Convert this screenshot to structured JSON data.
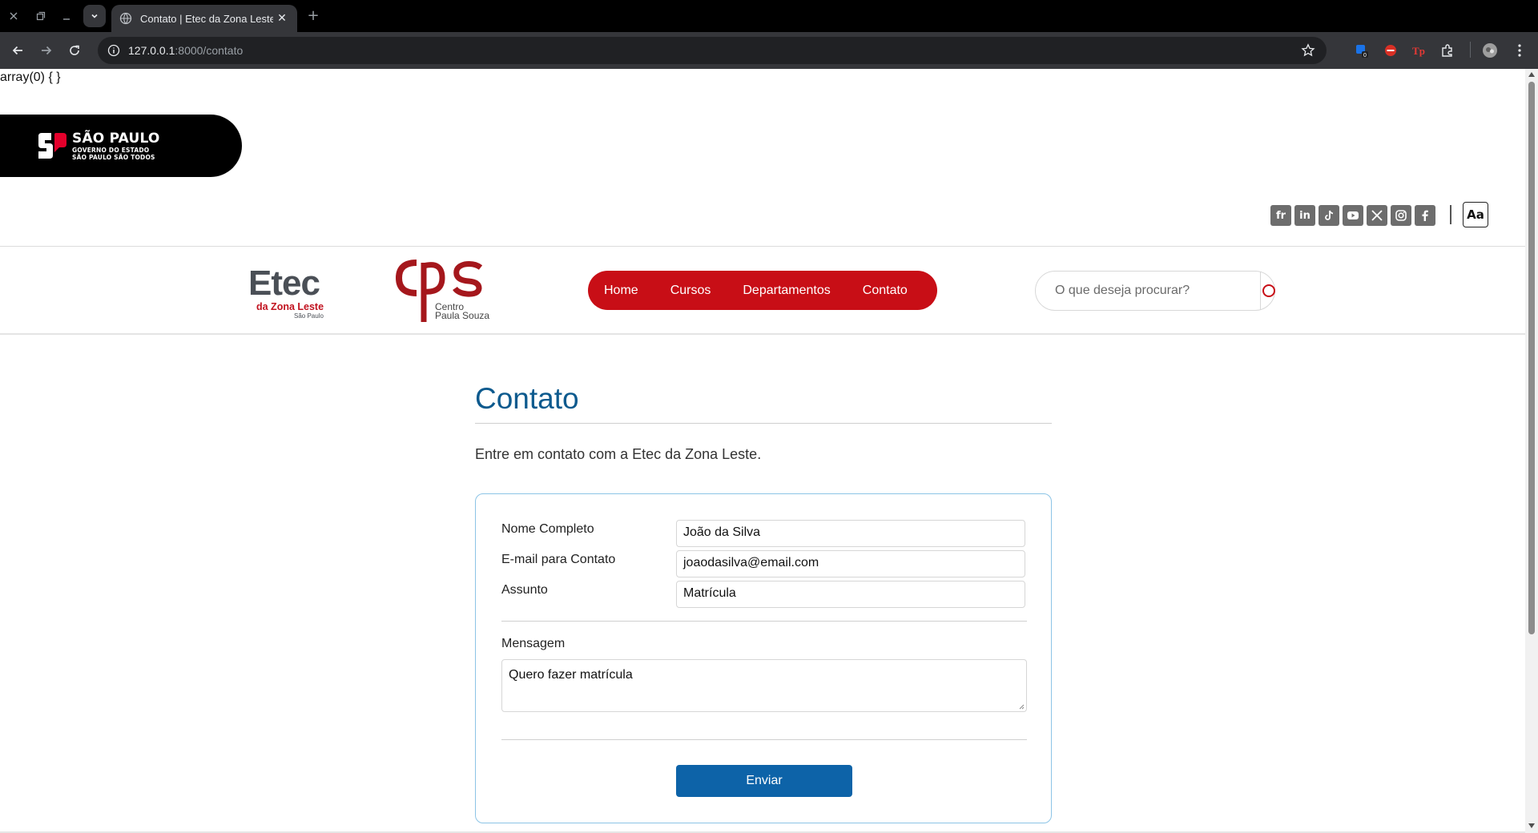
{
  "browser": {
    "tab_title": "Contato | Etec da Zona Leste",
    "tab_close": "✕",
    "new_tab": "+",
    "url_host": "127.0.0.1",
    "url_path": ":8000/contato"
  },
  "debug_output": "array(0) { }",
  "gov_logo": {
    "line1": "SÃO PAULO",
    "line2": "GOVERNO DO ESTADO",
    "line3": "SÃO PAULO SÃO TODOS"
  },
  "social": [
    "fr",
    "in"
  ],
  "accessibility_button": "Aa",
  "etec_logo": {
    "line1": "Etec",
    "line2": "da Zona Leste",
    "line3": "São Paulo"
  },
  "cps_logo": {
    "line1": "Centro",
    "line2": "Paula Souza"
  },
  "nav": {
    "items": [
      "Home",
      "Cursos",
      "Departamentos",
      "Contato"
    ]
  },
  "search": {
    "placeholder": "O que deseja procurar?"
  },
  "page": {
    "title": "Contato",
    "lead": "Entre em contato com a Etec da Zona Leste."
  },
  "form": {
    "name_label": "Nome Completo",
    "name_value": "João da Silva",
    "email_label": "E-mail para Contato",
    "email_value": "joaodasilva@email.com",
    "subject_label": "Assunto",
    "subject_value": "Matrícula",
    "message_label": "Mensagem",
    "message_value": "Quero fazer matrícula",
    "submit_label": "Enviar"
  },
  "colors": {
    "brand_red": "#c80e16",
    "title_blue": "#0d5a8e",
    "button_blue": "#0d63a8",
    "card_border": "#8cc4e6"
  }
}
